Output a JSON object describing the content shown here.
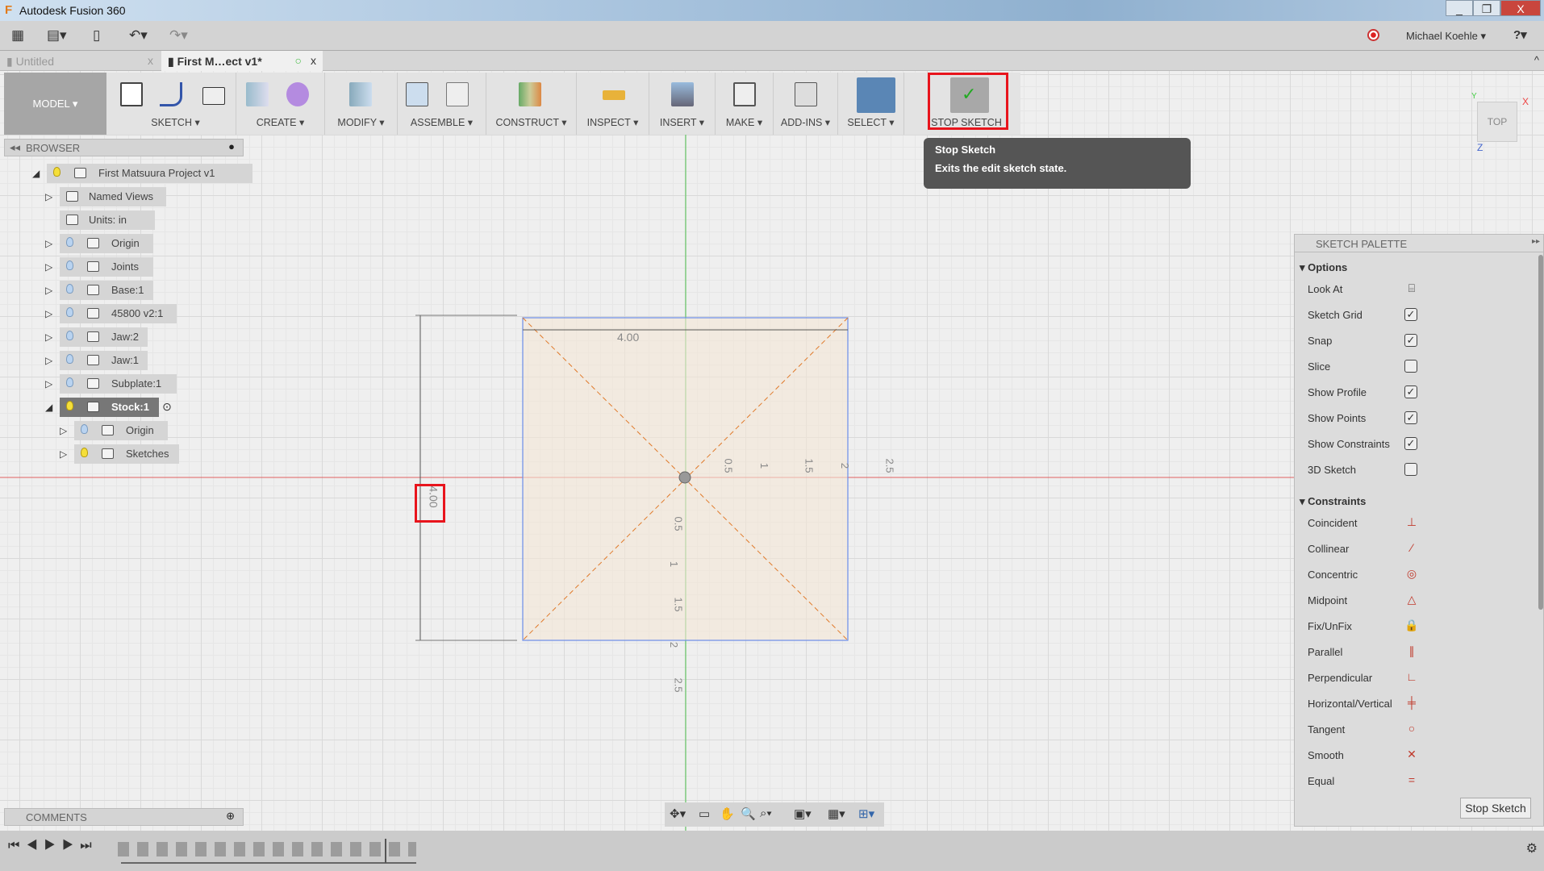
{
  "window": {
    "title": "Autodesk Fusion 360",
    "minimize": "_",
    "restore": "❐",
    "close": "X"
  },
  "qat": {
    "user": "Michael Koehle",
    "help": "?"
  },
  "tabs": [
    {
      "label": "Untitled",
      "close": "x"
    },
    {
      "label": "First M…ect v1*",
      "close": "x"
    }
  ],
  "ribbon": {
    "workspace": "MODEL",
    "groups": [
      "SKETCH",
      "CREATE",
      "MODIFY",
      "ASSEMBLE",
      "CONSTRUCT",
      "INSPECT",
      "INSERT",
      "MAKE",
      "ADD-INS",
      "SELECT",
      "STOP SKETCH"
    ]
  },
  "tooltip": {
    "title": "Stop Sketch",
    "body": "Exits the edit sketch state."
  },
  "viewcube": {
    "face": "TOP",
    "x": "X",
    "y": "Y",
    "z": "Z"
  },
  "browser": {
    "title": "BROWSER",
    "items": [
      {
        "label": "First Matsuura Project v1",
        "level": 0,
        "expanded": true,
        "visible": true,
        "icon": "assembly"
      },
      {
        "label": "Named Views",
        "level": 1,
        "icon": "folder"
      },
      {
        "label": "Units: in",
        "level": 1,
        "icon": "units"
      },
      {
        "label": "Origin",
        "level": 1,
        "visible": false,
        "icon": "folder"
      },
      {
        "label": "Joints",
        "level": 1,
        "visible": false,
        "icon": "folder"
      },
      {
        "label": "Base:1",
        "level": 1,
        "visible": false,
        "icon": "component"
      },
      {
        "label": "45800 v2:1",
        "level": 1,
        "visible": false,
        "icon": "component"
      },
      {
        "label": "Jaw:2",
        "level": 1,
        "visible": false,
        "icon": "component"
      },
      {
        "label": "Jaw:1",
        "level": 1,
        "visible": false,
        "icon": "component"
      },
      {
        "label": "Subplate:1",
        "level": 1,
        "visible": false,
        "icon": "component"
      },
      {
        "label": "Stock:1",
        "level": 1,
        "expanded": true,
        "visible": true,
        "active": true,
        "icon": "component"
      },
      {
        "label": "Origin",
        "level": 2,
        "visible": false,
        "icon": "folder"
      },
      {
        "label": "Sketches",
        "level": 2,
        "visible": true,
        "icon": "folder"
      }
    ]
  },
  "comments": {
    "title": "COMMENTS"
  },
  "sketch": {
    "dim_horizontal": "4.00",
    "dim_vertical": "4.00",
    "axis_x_ticks": [
      "0.5",
      "1",
      "1.5",
      "2",
      "2.5"
    ],
    "axis_y_ticks": [
      "0.5",
      "1",
      "1.5",
      "2",
      "2.5"
    ]
  },
  "palette": {
    "title": "SKETCH PALETTE",
    "options_title": "Options",
    "options": [
      {
        "label": "Look At",
        "type": "button"
      },
      {
        "label": "Sketch Grid",
        "checked": true
      },
      {
        "label": "Snap",
        "checked": true
      },
      {
        "label": "Slice",
        "checked": false
      },
      {
        "label": "Show Profile",
        "checked": true
      },
      {
        "label": "Show Points",
        "checked": true
      },
      {
        "label": "Show Constraints",
        "checked": true
      },
      {
        "label": "3D Sketch",
        "checked": false
      }
    ],
    "constraints_title": "Constraints",
    "constraints": [
      {
        "label": "Coincident",
        "glyph": "⊥"
      },
      {
        "label": "Collinear",
        "glyph": "⁄"
      },
      {
        "label": "Concentric",
        "glyph": "◎"
      },
      {
        "label": "Midpoint",
        "glyph": "△"
      },
      {
        "label": "Fix/UnFix",
        "glyph": "🔒"
      },
      {
        "label": "Parallel",
        "glyph": "∥"
      },
      {
        "label": "Perpendicular",
        "glyph": "∟"
      },
      {
        "label": "Horizontal/Vertical",
        "glyph": "╪"
      },
      {
        "label": "Tangent",
        "glyph": "○"
      },
      {
        "label": "Smooth",
        "glyph": "✕"
      },
      {
        "label": "Equal",
        "glyph": "="
      }
    ],
    "stop_button": "Stop Sketch"
  },
  "colors": {
    "accent_red": "#e8141c",
    "sketch_fill": "#f3e6d6",
    "profile_line": "#6b8ee8",
    "construction": "#e07a2a",
    "x_axis": "#e06060",
    "y_axis": "#4fc24f"
  }
}
